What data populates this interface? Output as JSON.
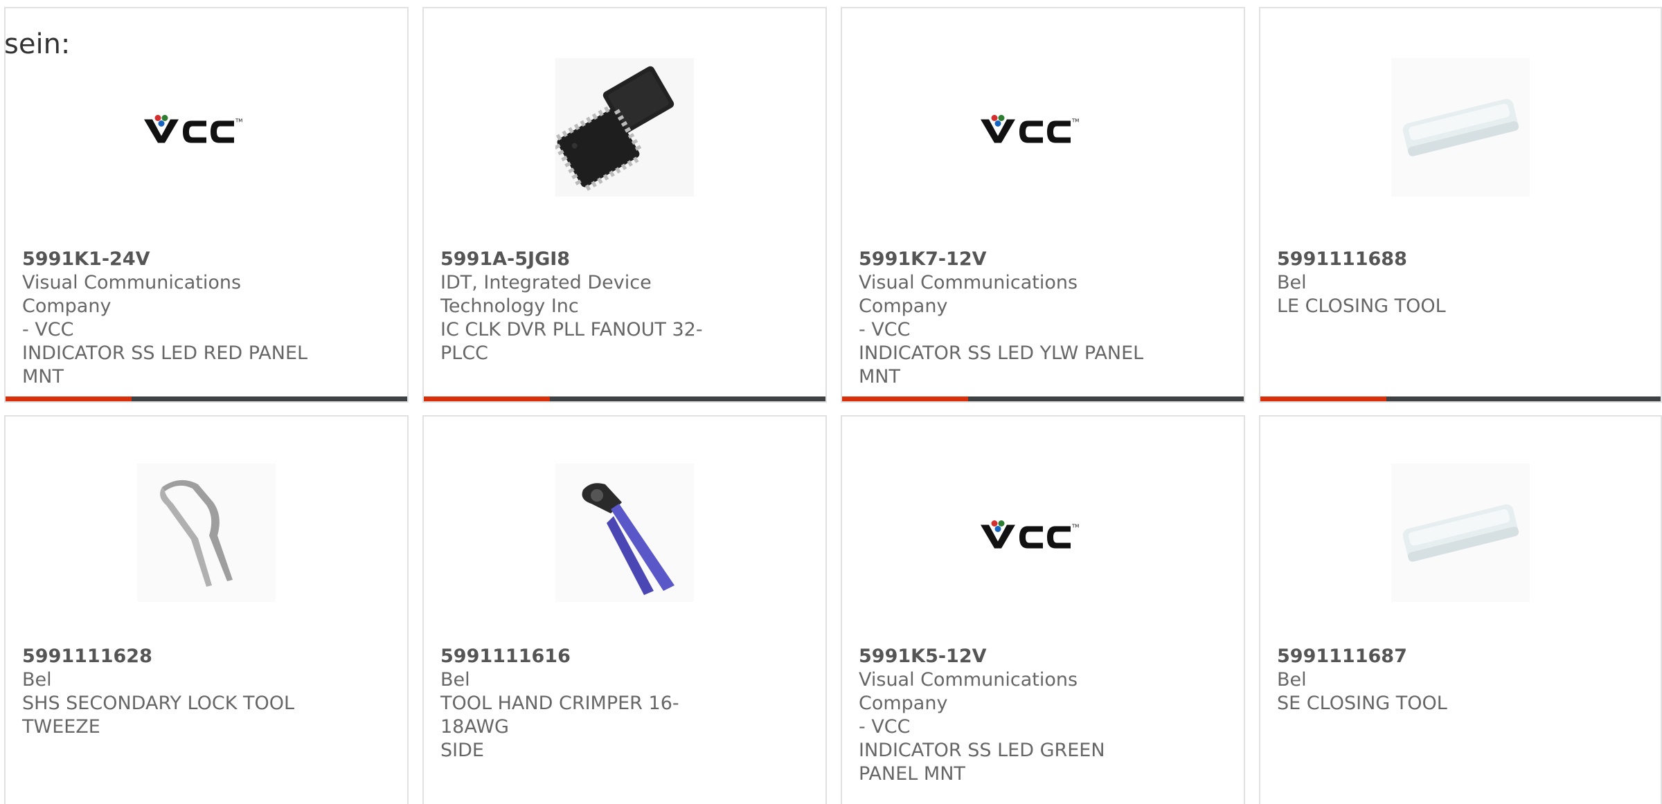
{
  "intro_text": "sein:",
  "colors": {
    "accent": "#d9300c",
    "bar": "#3f4143",
    "border": "#e1e1e1",
    "text": "#666666"
  },
  "products": [
    {
      "part_number": "5991K1-24V",
      "manufacturer_lines": [
        "Visual Communications Company",
        "- VCC"
      ],
      "description_lines": [
        "INDICATOR SS LED RED PANEL",
        "MNT"
      ],
      "image": "vcc-logo"
    },
    {
      "part_number": "5991A-5JGI8",
      "manufacturer_lines": [
        "IDT, Integrated Device",
        "Technology Inc"
      ],
      "description_lines": [
        "IC CLK DVR PLL FANOUT 32-",
        "PLCC"
      ],
      "image": "plcc-chip"
    },
    {
      "part_number": "5991K7-12V",
      "manufacturer_lines": [
        "Visual Communications Company",
        "- VCC"
      ],
      "description_lines": [
        "INDICATOR SS LED YLW PANEL",
        "MNT"
      ],
      "image": "vcc-logo"
    },
    {
      "part_number": "5991111688",
      "manufacturer_lines": [
        "Bel"
      ],
      "description_lines": [
        "LE CLOSING TOOL"
      ],
      "image": "closing-tool"
    },
    {
      "part_number": "5991111628",
      "manufacturer_lines": [
        "Bel"
      ],
      "description_lines": [
        "SHS SECONDARY LOCK TOOL",
        "TWEEZE"
      ],
      "image": "tweezer"
    },
    {
      "part_number": "5991111616",
      "manufacturer_lines": [
        "Bel"
      ],
      "description_lines": [
        "TOOL HAND CRIMPER 16-18AWG",
        "SIDE"
      ],
      "image": "hand-crimper"
    },
    {
      "part_number": "5991K5-12V",
      "manufacturer_lines": [
        "Visual Communications Company",
        "- VCC"
      ],
      "description_lines": [
        "INDICATOR SS LED GREEN",
        "PANEL MNT"
      ],
      "image": "vcc-logo"
    },
    {
      "part_number": "5991111687",
      "manufacturer_lines": [
        "Bel"
      ],
      "description_lines": [
        "SE CLOSING TOOL"
      ],
      "image": "closing-tool"
    }
  ]
}
